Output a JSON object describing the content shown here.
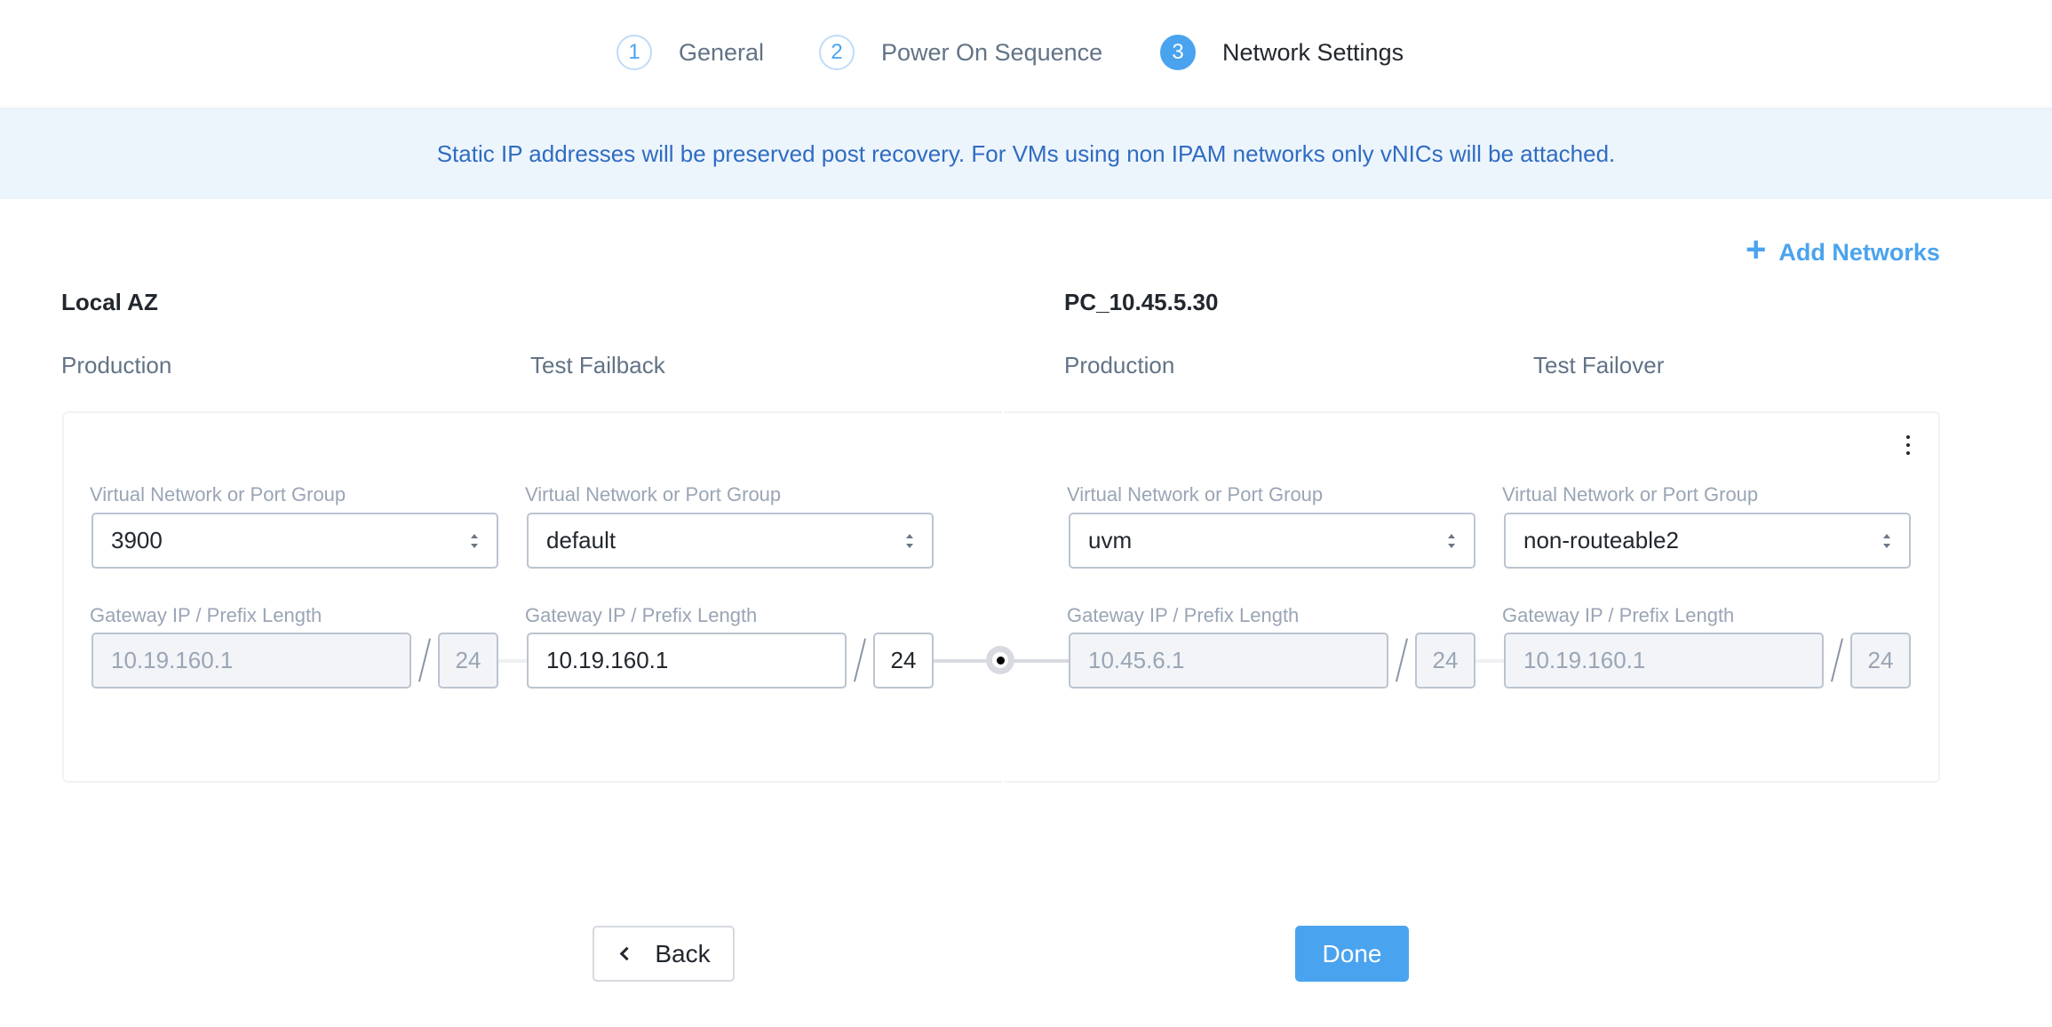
{
  "stepper": {
    "steps": [
      {
        "number": "1",
        "label": "General",
        "state": "incomplete"
      },
      {
        "number": "2",
        "label": "Power On Sequence",
        "state": "incomplete"
      },
      {
        "number": "3",
        "label": "Network Settings",
        "state": "active"
      }
    ]
  },
  "banner": {
    "text": "Static IP addresses will be preserved post recovery. For VMs using non IPAM networks only vNICs will be attached."
  },
  "add_networks": {
    "icon": "plus-icon",
    "label": "Add Networks"
  },
  "local_az": {
    "title": "Local AZ",
    "columns": [
      {
        "title": "Production",
        "network_label": "Virtual Network or Port Group",
        "network_value": "3900",
        "gateway_label": "Gateway IP / Prefix Length",
        "gateway_ip": "10.19.160.1",
        "prefix_length": "24",
        "editable": false
      },
      {
        "title": "Test Failback",
        "network_label": "Virtual Network or Port Group",
        "network_value": "default",
        "gateway_label": "Gateway IP / Prefix Length",
        "gateway_ip": "10.19.160.1",
        "prefix_length": "24",
        "editable": true
      }
    ]
  },
  "remote_az": {
    "title": "PC_10.45.5.30",
    "columns": [
      {
        "title": "Production",
        "network_label": "Virtual Network or Port Group",
        "network_value": "uvm",
        "gateway_label": "Gateway IP / Prefix Length",
        "gateway_ip": "10.45.6.1",
        "prefix_length": "24",
        "editable": false
      },
      {
        "title": "Test Failover",
        "network_label": "Virtual Network or Port Group",
        "network_value": "non-routeable2",
        "gateway_label": "Gateway IP / Prefix Length",
        "gateway_ip": "10.19.160.1",
        "prefix_length": "24",
        "editable": false
      }
    ]
  },
  "footer": {
    "back_label": "Back",
    "done_label": "Done"
  },
  "colors": {
    "accent": "#4aa3ee",
    "banner_bg": "#edf5fc",
    "banner_text": "#2f6cc2"
  }
}
